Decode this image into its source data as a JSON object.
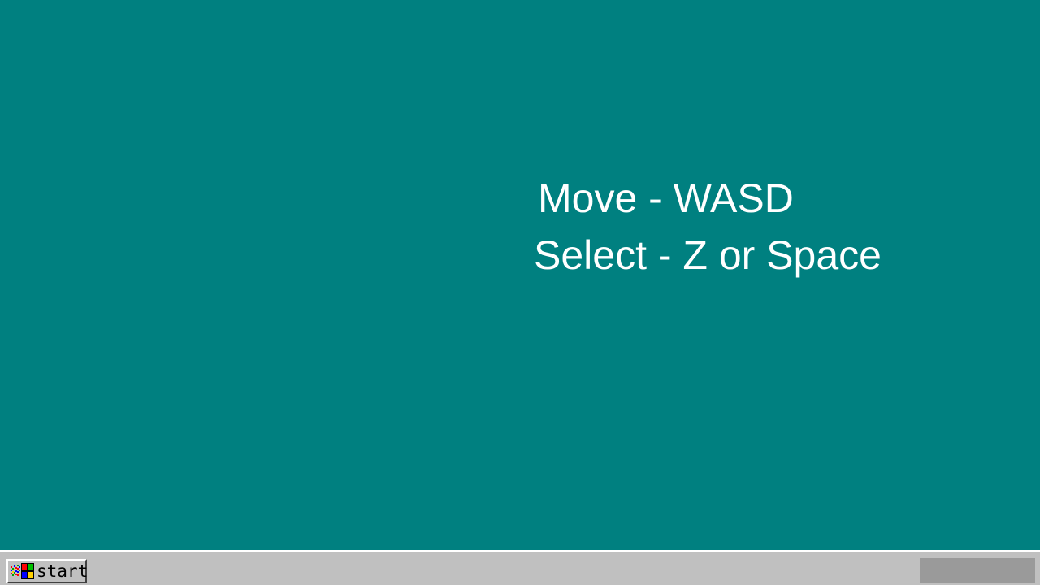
{
  "desktop": {
    "background_color": "#008080",
    "instructions": {
      "move": "Move - WASD",
      "select": "Select - Z or Space"
    }
  },
  "taskbar": {
    "start_label": "start",
    "start_icon": "windows-flag-icon",
    "tray_color": "#9a9a9a"
  }
}
